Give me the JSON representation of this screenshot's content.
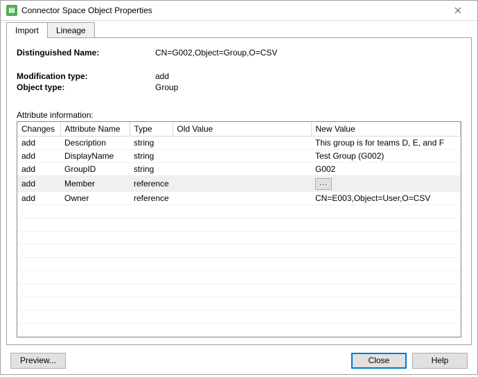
{
  "window": {
    "title": "Connector Space Object Properties"
  },
  "tabs": [
    {
      "label": "Import",
      "active": true
    },
    {
      "label": "Lineage",
      "active": false
    }
  ],
  "fields": {
    "distinguishedName": {
      "label": "Distinguished Name:",
      "value": "CN=G002,Object=Group,O=CSV"
    },
    "modificationType": {
      "label": "Modification type:",
      "value": "add"
    },
    "objectType": {
      "label": "Object type:",
      "value": "Group"
    }
  },
  "attributeInfo": {
    "title": "Attribute information:",
    "columns": [
      "Changes",
      "Attribute Name",
      "Type",
      "Old Value",
      "New Value"
    ],
    "rows": [
      {
        "changes": "add",
        "attr": "Description",
        "type": "string",
        "old": "",
        "new": "This group is for teams D, E, and F",
        "isRef": false,
        "hl": false
      },
      {
        "changes": "add",
        "attr": "DisplayName",
        "type": "string",
        "old": "",
        "new": "Test Group (G002)",
        "isRef": false,
        "hl": false
      },
      {
        "changes": "add",
        "attr": "GroupID",
        "type": "string",
        "old": "",
        "new": "G002",
        "isRef": false,
        "hl": false
      },
      {
        "changes": "add",
        "attr": "Member",
        "type": "reference",
        "old": "",
        "new": "",
        "isRef": true,
        "hl": true
      },
      {
        "changes": "add",
        "attr": "Owner",
        "type": "reference",
        "old": "",
        "new": "CN=E003,Object=User,O=CSV",
        "isRef": false,
        "hl": false
      }
    ],
    "emptyRows": 10
  },
  "buttons": {
    "preview": "Preview...",
    "close": "Close",
    "help": "Help"
  },
  "icons": {
    "ellipsis": "..."
  }
}
